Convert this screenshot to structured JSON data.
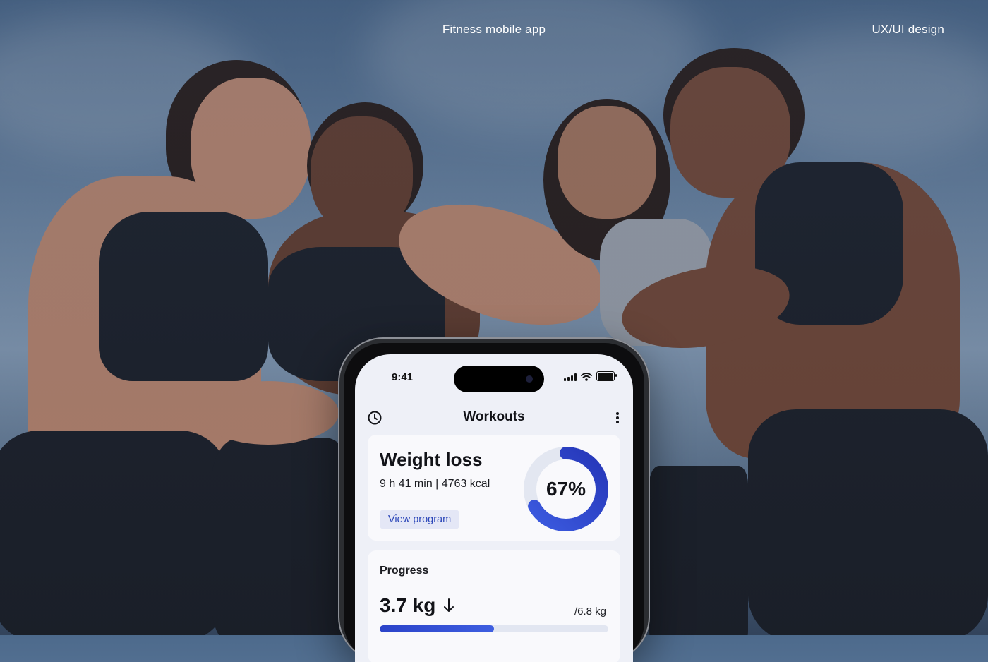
{
  "header": {
    "center_title": "Fitness mobile app",
    "right_label": "UX/UI design"
  },
  "phone": {
    "status_bar": {
      "time": "9:41",
      "icons": [
        "cellular-signal-icon",
        "wifi-icon",
        "battery-icon"
      ]
    },
    "topbar": {
      "title": "Workouts",
      "left_icon": "clock-icon",
      "right_icon": "more-vertical-icon"
    },
    "weight_loss_card": {
      "title": "Weight loss",
      "meta": "9 h 41 min | 4763 kcal",
      "button_label": "View program",
      "progress_percent_label": "67%",
      "progress_fraction": 0.67
    },
    "progress_card": {
      "label": "Progress",
      "value": "3.7 kg",
      "trend_icon": "arrow-down-icon",
      "total": "/6.8 kg",
      "fill_fraction": 0.5
    }
  },
  "colors": {
    "accent": "#2b43c9",
    "accent_light": "#e4e7f6",
    "screen_bg": "#eef0f7",
    "card_bg": "#f9f9fc"
  }
}
